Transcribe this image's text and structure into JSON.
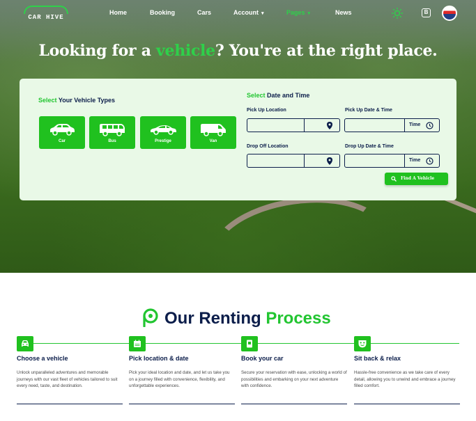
{
  "brand": {
    "logo_text": "CAR HIVE"
  },
  "nav": {
    "items": [
      {
        "label": "Home",
        "dropdown": false,
        "active": false
      },
      {
        "label": "Booking",
        "dropdown": false,
        "active": false
      },
      {
        "label": "Cars",
        "dropdown": false,
        "active": false
      },
      {
        "label": "Account",
        "dropdown": true,
        "active": false
      },
      {
        "label": "Pages",
        "dropdown": true,
        "active": true
      },
      {
        "label": "News",
        "dropdown": false,
        "active": false
      }
    ],
    "caret": "▾",
    "icons": [
      "sun-icon",
      "b-icon",
      "avatar"
    ],
    "b_icon_text": "B"
  },
  "hero": {
    "title_pre": "Looking for a ",
    "title_highlight": "vehicle",
    "title_post": "? You're at the right place."
  },
  "search": {
    "vehicle_section": {
      "title_green": "Select",
      "title_rest": " Your Vehicle Types"
    },
    "vehicle_types": [
      {
        "label": "Car",
        "icon": "car-icon"
      },
      {
        "label": "Bus",
        "icon": "bus-icon"
      },
      {
        "label": "Prestige",
        "icon": "sports-car-icon"
      },
      {
        "label": "Van",
        "icon": "van-icon"
      }
    ],
    "date_section": {
      "title_green": "Select",
      "title_rest": " Date and Time"
    },
    "pickup_location_label": "Pick Up Location",
    "pickup_date_label": "Pick Up Date & Time",
    "dropoff_location_label": "Drop Off Location",
    "dropoff_date_label": "Drop Up Date & Time",
    "time_text": "Time",
    "find_button": "Find A Vehicle"
  },
  "process": {
    "title_main": "Our Renting",
    "title_green": "Process",
    "steps": [
      {
        "title": "Choose a vehicle",
        "icon": "car-front-icon",
        "desc": "Unlock unparalleled adventures and memorable journeys with our vast fleet of vehicles tailored to suit every need, taste, and destination."
      },
      {
        "title": "Pick location & date",
        "icon": "calendar-icon",
        "desc": "Pick your ideal location and date, and let us take you on a journey filled with convenience, flexibility, and unforgettable experiences."
      },
      {
        "title": "Book your car",
        "icon": "book-icon",
        "desc": "Secure your reservation with ease, unlocking a world of possibilities and embarking on your next adventure with confidence."
      },
      {
        "title": "Sit back & relax",
        "icon": "mask-icon",
        "desc": "Hassle-free convenience as we take care of every detail, allowing you to unwind and embrace a journey filled comfort."
      }
    ]
  },
  "colors": {
    "accent_green": "#20c11f",
    "navy": "#0b1d4a",
    "panel_bg": "#e9f9e7"
  }
}
